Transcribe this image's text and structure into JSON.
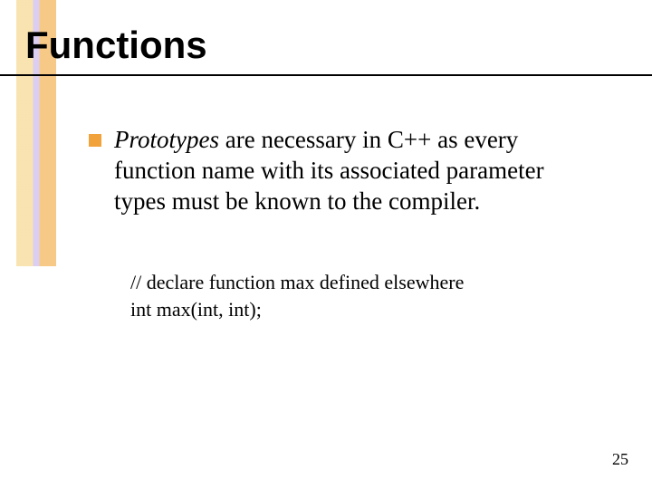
{
  "title": "Functions",
  "bullet": {
    "emphasis": "Prototypes",
    "rest": " are necessary in C++ as every function name with its associated parameter types must be known to the compiler."
  },
  "code": {
    "line1": "// declare function max defined elsewhere",
    "line2": "int max(int, int);"
  },
  "page_number": "25"
}
